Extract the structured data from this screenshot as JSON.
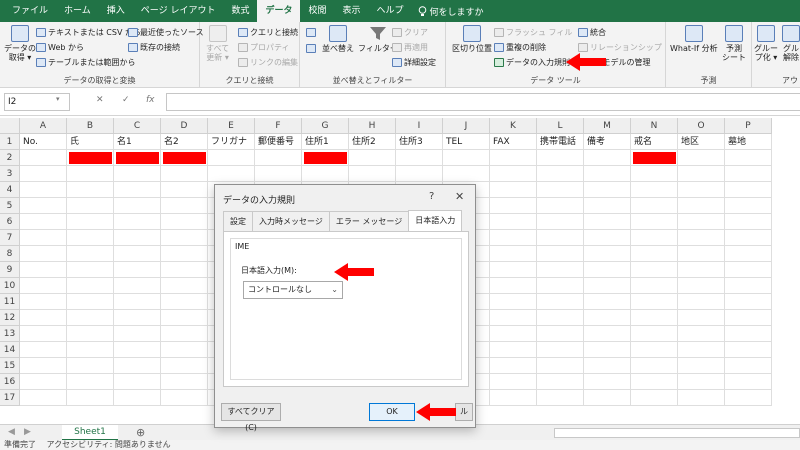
{
  "ribbon_tabs": [
    "ファイル",
    "ホーム",
    "挿入",
    "ページ レイアウト",
    "数式",
    "データ",
    "校閲",
    "表示",
    "ヘルプ"
  ],
  "active_tab": "データ",
  "tell_me": "何をしますか",
  "ribbon": {
    "get_data_big": "データの\n取得 ▾",
    "from_text_csv": "テキストまたは CSV から",
    "from_web": "Web から",
    "from_table": "テーブルまたは範囲から",
    "recent_sources": "最近使ったソース",
    "existing_connections": "既存の接続",
    "group_get_data": "データの取得と変換",
    "refresh_all": "すべて\n更新 ▾",
    "queries_connections": "クエリと接続",
    "properties": "プロパティ",
    "edit_links": "リンクの編集",
    "group_queries": "クエリと接続",
    "sort": "並べ替え",
    "filter": "フィルター",
    "clear": "クリア",
    "reapply": "再適用",
    "advanced": "詳細設定",
    "group_sort_filter": "並べ替えとフィルター",
    "text_to_columns": "区切り位置",
    "flash_fill": "フラッシュ フィル",
    "remove_duplicates": "重複の削除",
    "data_validation": "データの入力規則",
    "consolidate": "統合",
    "relationships": "リレーションシップ",
    "manage_model": "タ モデルの管理",
    "group_data_tools": "データ ツール",
    "what_if": "What-If 分析",
    "forecast_sheet": "予測\nシート",
    "group_forecast": "予測",
    "group_btn": "グルー\nプ化 ▾",
    "ungroup_btn": "グル\n解除",
    "group_outline": "アウト"
  },
  "formula_bar": {
    "name_box": "I2",
    "cancel": "✕",
    "enter": "✓",
    "fx": "fx",
    "value": ""
  },
  "columns": [
    "A",
    "B",
    "C",
    "D",
    "E",
    "F",
    "G",
    "H",
    "I",
    "J",
    "K",
    "L",
    "M",
    "N",
    "O",
    "P"
  ],
  "rows": [
    "1",
    "2",
    "3",
    "4",
    "5",
    "6",
    "7",
    "8",
    "9",
    "10",
    "11",
    "12",
    "13",
    "14",
    "15",
    "16",
    "17"
  ],
  "header_row": [
    "No.",
    "氏",
    "名1",
    "名2",
    "フリガナ",
    "郵便番号",
    "住所1",
    "住所2",
    "住所3",
    "TEL",
    "FAX",
    "携帯電話",
    "備考",
    "戒名",
    "地区",
    "墓地"
  ],
  "redacted_cells_row2": [
    "B",
    "C",
    "D",
    "G",
    "N"
  ],
  "sheet_tab": "Sheet1",
  "add_sheet": "⊕",
  "status": "準備完了　 アクセシビリティ: 問題ありません",
  "dialog": {
    "title": "データの入力規則",
    "help": "?",
    "close": "✕",
    "tabs": [
      "設定",
      "入力時メッセージ",
      "エラー メッセージ",
      "日本語入力"
    ],
    "active_tab": "日本語入力",
    "group_title": "IME",
    "ime_label": "日本語入力(M):",
    "ime_value": "コントロールなし",
    "clear_all": "すべてクリア(C)",
    "ok": "OK",
    "cancel_partial": "ル"
  },
  "colors": {
    "excel_green": "#217346",
    "highlight_red": "#ff0000"
  }
}
